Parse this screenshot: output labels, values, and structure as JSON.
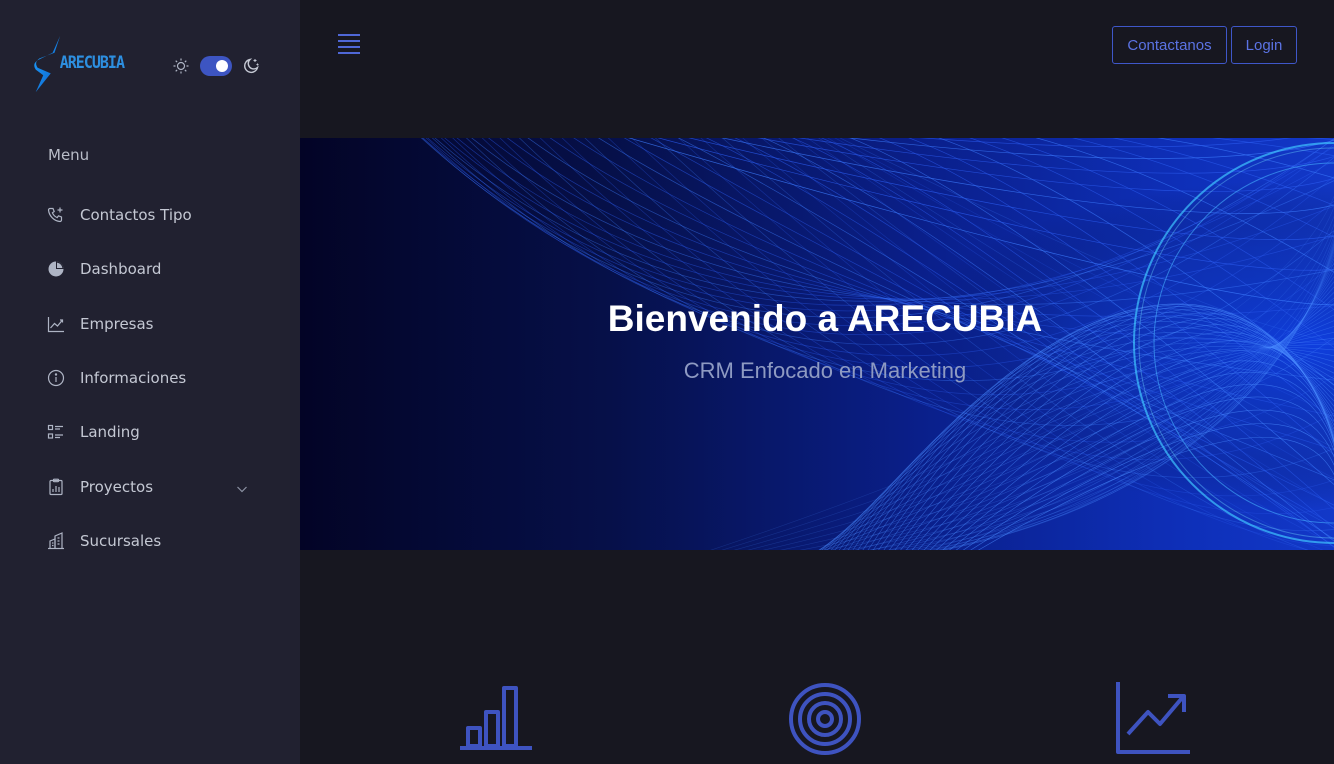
{
  "brand": {
    "logo_text": "ARECUBIA"
  },
  "colors": {
    "accent": "#3d55c2",
    "accent_text": "#5b73e4",
    "sidebar_bg": "#212130",
    "page_bg": "#171720",
    "icon_blue": "#3e53c0"
  },
  "theme_toggle": {
    "left_icon": "sun-icon",
    "right_icon": "moon-stars-icon",
    "state": "on"
  },
  "sidebar": {
    "menu_title": "Menu",
    "items": [
      {
        "label": "Contactos Tipo",
        "icon": "phone-plus-icon"
      },
      {
        "label": "Dashboard",
        "icon": "pie-chart-icon"
      },
      {
        "label": "Empresas",
        "icon": "line-chart-icon"
      },
      {
        "label": "Informaciones",
        "icon": "info-icon"
      },
      {
        "label": "Landing",
        "icon": "checklist-icon"
      },
      {
        "label": "Proyectos",
        "icon": "clipboard-chart-icon",
        "has_submenu": true
      },
      {
        "label": "Sucursales",
        "icon": "building-icon"
      }
    ]
  },
  "header": {
    "menu_icon": "hamburger-icon",
    "contact_label": "Contactanos",
    "login_label": "Login"
  },
  "hero": {
    "title": "Bienvenido a ARECUBIA",
    "subtitle": "CRM Enfocado en Marketing"
  },
  "features": [
    {
      "icon": "bar-chart-icon"
    },
    {
      "icon": "target-icon"
    },
    {
      "icon": "trend-up-icon"
    }
  ]
}
